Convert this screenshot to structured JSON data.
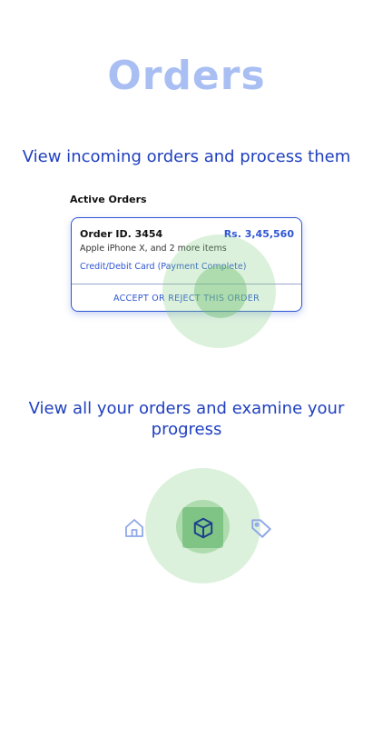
{
  "header": {
    "title": "Orders"
  },
  "sections": {
    "orders_intro": "View incoming orders and process them",
    "progress_intro": "View all your orders and examine your progress"
  },
  "active_orders": {
    "label": "Active Orders",
    "card": {
      "order_id": "Order ID. 3454",
      "amount": "Rs. 3,45,560",
      "items": "Apple iPhone X, and 2 more items",
      "payment": "Credit/Debit Card (Payment Complete)",
      "action": "ACCEPT OR REJECT THIS ORDER"
    }
  },
  "bottom_nav": {
    "items": [
      {
        "icon": "home-icon"
      },
      {
        "icon": "package-box-icon",
        "selected": true
      },
      {
        "icon": "tag-icon"
      }
    ]
  },
  "colors": {
    "accent": "#2e55d3",
    "title": "#a9bff3",
    "subtitle": "#1f3fbf",
    "touch_highlight": "#82cd82"
  }
}
